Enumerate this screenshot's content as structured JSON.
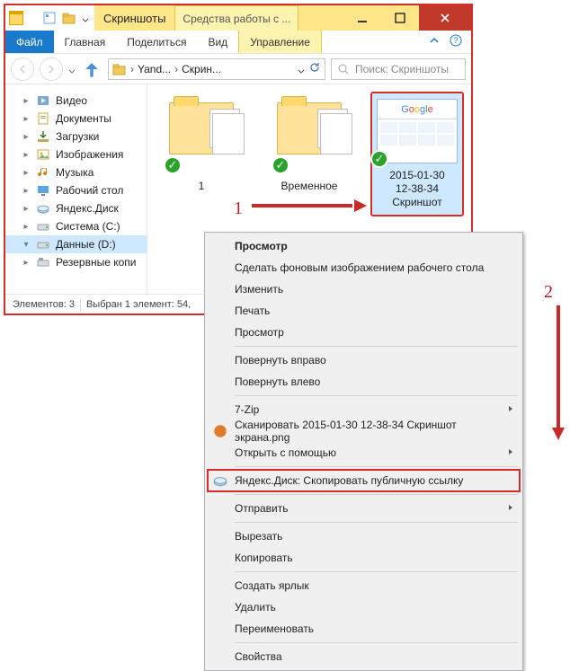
{
  "window": {
    "title": "Скриншоты",
    "tab2": "Средства работы с ..."
  },
  "ribbon": {
    "file": "Файл",
    "main": "Главная",
    "share": "Поделиться",
    "view": "Вид",
    "manage": "Управление"
  },
  "address": {
    "crumb1": "Yand...",
    "crumb2": "Скрин...",
    "search_placeholder": "Поиск: Скриншоты"
  },
  "tree": {
    "items": [
      {
        "label": "Видео",
        "icon": "video"
      },
      {
        "label": "Документы",
        "icon": "doc"
      },
      {
        "label": "Загрузки",
        "icon": "download"
      },
      {
        "label": "Изображения",
        "icon": "image"
      },
      {
        "label": "Музыка",
        "icon": "music"
      },
      {
        "label": "Рабочий стол",
        "icon": "desktop"
      },
      {
        "label": "Яндекс.Диск",
        "icon": "ydisk"
      },
      {
        "label": "Система (C:)",
        "icon": "drive"
      },
      {
        "label": "Данные (D:)",
        "icon": "drive",
        "selected": true,
        "expand": "▾"
      },
      {
        "label": "Резервные копи",
        "icon": "drive-ext"
      }
    ]
  },
  "files": {
    "items": [
      {
        "name": "1",
        "type": "folder"
      },
      {
        "name": "Временное",
        "type": "folder"
      },
      {
        "name": "2015-01-30 12-38-34 Скриншот",
        "type": "image",
        "selected": true
      }
    ]
  },
  "status": {
    "count_label": "Элементов: 3",
    "sel_label": "Выбран 1 элемент: 54,"
  },
  "annotations": {
    "a1": "1",
    "a2": "2"
  },
  "context_menu": {
    "items": [
      {
        "label": "Просмотр",
        "bold": true
      },
      {
        "label": "Сделать фоновым изображением рабочего стола"
      },
      {
        "label": "Изменить"
      },
      {
        "label": "Печать"
      },
      {
        "label": "Просмотр"
      },
      {
        "sep": true
      },
      {
        "label": "Повернуть вправо"
      },
      {
        "label": "Повернуть влево"
      },
      {
        "sep": true
      },
      {
        "label": "7-Zip",
        "submenu": true
      },
      {
        "label": "Сканировать 2015-01-30 12-38-34 Скриншот экрана.png",
        "icon": "warn"
      },
      {
        "label": "Открыть с помощью",
        "submenu": true
      },
      {
        "sep": true
      },
      {
        "label": "Яндекс.Диск: Скопировать публичную ссылку",
        "icon": "ydisk",
        "highlight": true
      },
      {
        "sep": true
      },
      {
        "label": "Отправить",
        "submenu": true
      },
      {
        "sep": true
      },
      {
        "label": "Вырезать"
      },
      {
        "label": "Копировать"
      },
      {
        "sep": true
      },
      {
        "label": "Создать ярлык"
      },
      {
        "label": "Удалить"
      },
      {
        "label": "Переименовать"
      },
      {
        "sep": true
      },
      {
        "label": "Свойства"
      }
    ]
  },
  "thumb_logo": "Google"
}
